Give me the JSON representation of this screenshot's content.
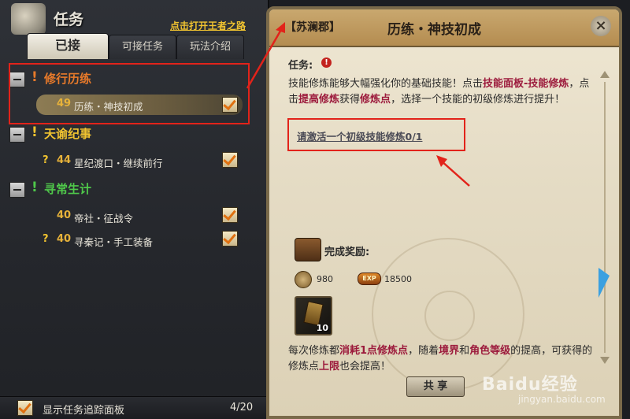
{
  "left": {
    "title": "任务",
    "link": "点击打开王者之路",
    "tabs": [
      "已接",
      "可接任务",
      "玩法介绍"
    ],
    "categories": [
      {
        "label": "修行历练",
        "color": "#e87a2a"
      },
      {
        "label": "天谕纪事",
        "color": "#f0c330"
      },
      {
        "label": "寻常生计",
        "color": "#4fc84a"
      }
    ],
    "quests": [
      {
        "mark": "",
        "level": "49",
        "name": "历练・神技初成",
        "checked": true,
        "selected": true
      },
      {
        "mark": "?",
        "level": "44",
        "name": "星纪渡口・继续前行",
        "checked": true
      },
      {
        "mark": "",
        "level": "40",
        "name": "帝社・征战令",
        "checked": true
      },
      {
        "mark": "?",
        "level": "40",
        "name": "寻秦记・手工装备",
        "checked": true
      }
    ],
    "track_label": "显示任务追踪面板",
    "count": "4/20"
  },
  "right": {
    "location": "【苏澜郡】",
    "title": "历练・神技初成",
    "close_icon": "×",
    "task_label": "任务:",
    "task_alert": "!",
    "desc": {
      "p1": "技能修炼能够大幅强化你的基础技能！点击",
      "h1": "技能面板-技能修炼",
      "p2": "，点击",
      "h2": "提高修炼",
      "p3": "获得",
      "h3": "修炼点",
      "p4": "，选择一个技能的初级修炼进行提升！"
    },
    "objective": "请激活一个初级技能修炼0/1",
    "reward_title": "完成奖励:",
    "coin_value": "980",
    "exp_label": "EXP",
    "exp_value": "18500",
    "item_count": "10",
    "bottom": {
      "p1": "每次修炼都",
      "h1": "消耗1点修炼点",
      "p2": "，随着",
      "h2": "境界",
      "p3": "和",
      "h3": "角色等级",
      "p4": "的提高，可获得的修炼点",
      "h4": "上限",
      "p5": "也会提高！"
    },
    "share_label": "共 享"
  },
  "watermark": {
    "main": "Baidu经验",
    "sub": "jingyan.baidu.com"
  }
}
